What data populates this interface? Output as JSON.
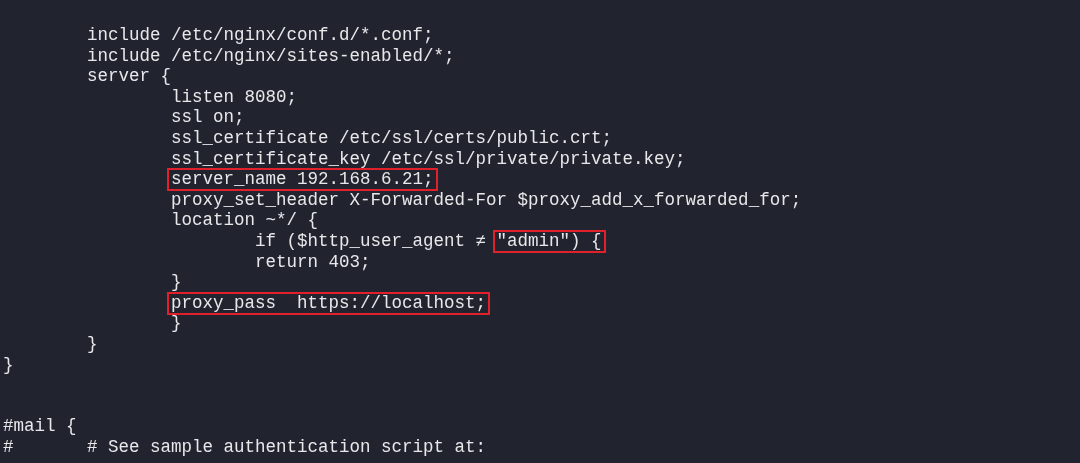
{
  "terminal": {
    "lines": [
      {
        "kind": "code",
        "segments": [
          {
            "text": "        include /etc/nginx/conf.d/*.conf;",
            "highlighted": false
          }
        ]
      },
      {
        "kind": "code",
        "segments": [
          {
            "text": "        include /etc/nginx/sites-enabled/*;",
            "highlighted": false
          }
        ]
      },
      {
        "kind": "code",
        "segments": [
          {
            "text": "        server {",
            "highlighted": false
          }
        ]
      },
      {
        "kind": "code",
        "segments": [
          {
            "text": "                listen 8080;",
            "highlighted": false
          }
        ]
      },
      {
        "kind": "code",
        "segments": [
          {
            "text": "                ssl on;",
            "highlighted": false
          }
        ]
      },
      {
        "kind": "code",
        "segments": [
          {
            "text": "                ssl_certificate /etc/ssl/certs/public.crt;",
            "highlighted": false
          }
        ]
      },
      {
        "kind": "code",
        "segments": [
          {
            "text": "                ssl_certificate_key /etc/ssl/private/private.key;",
            "highlighted": false
          }
        ]
      },
      {
        "kind": "code",
        "segments": [
          {
            "text": "                server_name 192.168.6.21;",
            "highlighted": true
          }
        ]
      },
      {
        "kind": "code",
        "segments": [
          {
            "text": "                proxy_set_header X-Forwarded-For $proxy_add_x_forwarded_for;",
            "highlighted": false
          }
        ]
      },
      {
        "kind": "code",
        "segments": [
          {
            "text": "                location ~*/ {",
            "highlighted": false
          }
        ]
      },
      {
        "kind": "code",
        "segments": [
          {
            "text": "                        if ($http_user_agent ≠ ",
            "highlighted": false
          },
          {
            "text": "\"admin\") {",
            "highlighted": true
          }
        ]
      },
      {
        "kind": "code",
        "segments": [
          {
            "text": "                        return 403;",
            "highlighted": false
          }
        ]
      },
      {
        "kind": "code",
        "segments": [
          {
            "text": "                }",
            "highlighted": false
          }
        ]
      },
      {
        "kind": "code",
        "segments": [
          {
            "text": "                proxy_pass  https://localhost;",
            "highlighted": true
          }
        ]
      },
      {
        "kind": "code",
        "segments": [
          {
            "text": "                }",
            "highlighted": false
          }
        ]
      },
      {
        "kind": "code",
        "segments": [
          {
            "text": "        }",
            "highlighted": false
          }
        ]
      },
      {
        "kind": "code",
        "segments": [
          {
            "text": "}",
            "highlighted": false
          }
        ]
      },
      {
        "kind": "blank"
      },
      {
        "kind": "blank"
      },
      {
        "kind": "code",
        "segments": [
          {
            "text": "#mail {",
            "highlighted": false
          }
        ]
      },
      {
        "kind": "code",
        "segments": [
          {
            "text": "#       # See sample authentication script at:",
            "highlighted": false
          }
        ]
      }
    ]
  }
}
